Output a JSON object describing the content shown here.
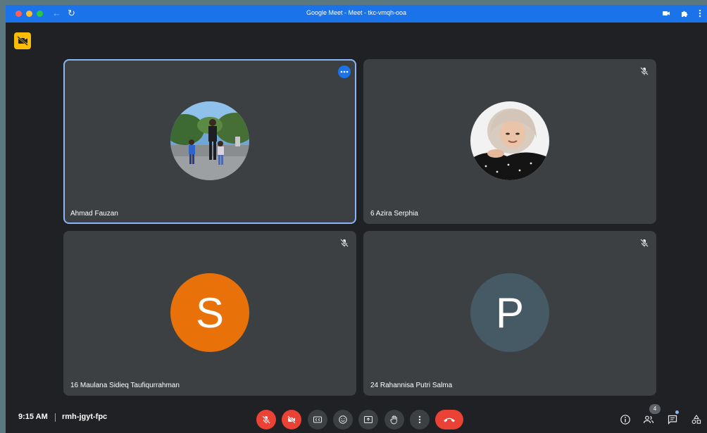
{
  "window": {
    "title": "Google Meet - Meet - tkc-vmqh-ooa"
  },
  "tiles": [
    {
      "name": "Ahmad Fauzan",
      "avatar": "photo",
      "muted": false,
      "active": true
    },
    {
      "name": "6 Azira Serphia",
      "avatar": "photo",
      "muted": true,
      "active": false
    },
    {
      "name": "16 Maulana Sidieq Taufiqurrahman",
      "avatar_letter": "S",
      "avatar_color": "#e8710a",
      "muted": true,
      "active": false
    },
    {
      "name": "24 Rahannisa Putri Salma",
      "avatar_letter": "P",
      "avatar_color": "#455a64",
      "muted": true,
      "active": false
    }
  ],
  "meeting": {
    "time": "9:15 AM",
    "code": "rmh-jgyt-fpc"
  },
  "participants": {
    "count": "4"
  },
  "colors": {
    "title_bar": "#1a73e8",
    "background": "#202124",
    "tile": "#3c4043",
    "danger": "#ea4335",
    "accent": "#8ab4f8",
    "camera_off_badge": "#fbbc04"
  },
  "icons": [
    "camera-off-icon",
    "mic-off-icon",
    "more-icon",
    "captions-icon",
    "emoji-icon",
    "present-icon",
    "hand-icon",
    "call-end-icon",
    "info-icon",
    "people-icon",
    "chat-icon",
    "activities-icon",
    "puzzle-icon"
  ]
}
